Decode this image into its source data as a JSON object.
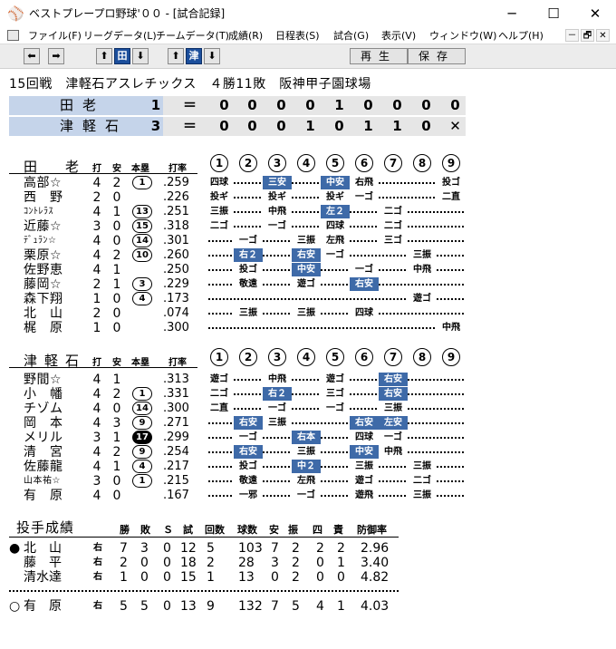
{
  "window": {
    "title": "ベストプレープロ野球'００ - [試合記録]",
    "minimize_glyph": "─",
    "maximize_glyph": "☐",
    "close_glyph": "✕"
  },
  "menu": {
    "items": [
      "ファイル(F)",
      "リーグデータ(L)",
      "チームデータ(T)",
      "成績(R)",
      "日程表(S)",
      "試合(G)",
      "表示(V)",
      "ウィンドウ(W)",
      "ヘルプ(H)"
    ],
    "mdi_min": "－",
    "mdi_restore": "🗗",
    "mdi_close": "✕"
  },
  "toolbar": {
    "prev_arrow": "⬅",
    "next_arrow": "➡",
    "team1_up": "⬆",
    "team1_label": "田",
    "team1_down": "⬇",
    "team2_up": "⬆",
    "team2_label": "津",
    "team2_down": "⬇",
    "replay_label": "再生",
    "save_label": "保存"
  },
  "game": {
    "header": "15回戦　津軽石アスレチックス　４勝11敗　阪神甲子園球場"
  },
  "scoreboard": [
    {
      "team": "田老",
      "total": "1",
      "eq": "＝",
      "innings": [
        "0",
        "0",
        "0",
        "0",
        "1",
        "0",
        "0",
        "0",
        "0"
      ]
    },
    {
      "team": "津軽石",
      "total": "3",
      "eq": "＝",
      "innings": [
        "0",
        "0",
        "0",
        "1",
        "0",
        "1",
        "1",
        "0",
        "✕"
      ]
    }
  ],
  "batting_headers": {
    "ab": "打",
    "h": "安",
    "hr": "本塁",
    "avg": "打率"
  },
  "inning_numbers": [
    "1",
    "2",
    "3",
    "4",
    "5",
    "6",
    "7",
    "8",
    "9"
  ],
  "batting": [
    {
      "team": "田　老",
      "players": [
        {
          "name": "高部☆",
          "ab": "4",
          "h": "2",
          "hr": "1",
          "avg": ".259",
          "results": [
            [
              "四球",
              1,
              false
            ],
            [
              "三安",
              3,
              true
            ],
            [
              "中安",
              5,
              true
            ],
            [
              "右飛",
              6,
              false
            ],
            [
              "投ゴ",
              9,
              false
            ]
          ]
        },
        {
          "name": "西　野",
          "ab": "2",
          "h": "0",
          "hr": "",
          "avg": ".226",
          "results": [
            [
              "投ギ",
              1,
              false
            ],
            [
              "投ギ",
              3,
              false
            ],
            [
              "投ギ",
              5,
              false
            ],
            [
              "一ゴ",
              6,
              false
            ],
            [
              "二直",
              9,
              false
            ]
          ]
        },
        {
          "name": "ｺﾝﾄﾚﾗｽ",
          "small": true,
          "ab": "4",
          "h": "1",
          "hr": "13",
          "avg": ".251",
          "results": [
            [
              "三振",
              1,
              false
            ],
            [
              "中飛",
              3,
              false
            ],
            [
              "左２",
              5,
              true
            ],
            [
              "二ゴ",
              7,
              false
            ]
          ]
        },
        {
          "name": "近藤☆",
          "ab": "3",
          "h": "0",
          "hr": "15",
          "avg": ".318",
          "results": [
            [
              "二ゴ",
              1,
              false
            ],
            [
              "一ゴ",
              3,
              false
            ],
            [
              "四球",
              5,
              false
            ],
            [
              "二ゴ",
              7,
              false
            ]
          ]
        },
        {
          "name": "ﾃﾞｭﾗﾝ☆",
          "small": true,
          "ab": "4",
          "h": "0",
          "hr": "14",
          "avg": ".301",
          "results": [
            [
              "一ゴ",
              2,
              false
            ],
            [
              "三振",
              4,
              false
            ],
            [
              "左飛",
              5,
              false
            ],
            [
              "三ゴ",
              7,
              false
            ]
          ]
        },
        {
          "name": "栗原☆",
          "ab": "4",
          "h": "2",
          "hr": "10",
          "avg": ".260",
          "results": [
            [
              "右２",
              2,
              true
            ],
            [
              "右安",
              4,
              true
            ],
            [
              "一ゴ",
              5,
              false
            ],
            [
              "三振",
              8,
              false
            ]
          ]
        },
        {
          "name": "佐野恵",
          "ab": "4",
          "h": "1",
          "hr": "",
          "avg": ".250",
          "results": [
            [
              "投ゴ",
              2,
              false
            ],
            [
              "中安",
              4,
              true
            ],
            [
              "一ゴ",
              6,
              false
            ],
            [
              "中飛",
              8,
              false
            ]
          ]
        },
        {
          "name": "藤岡☆",
          "ab": "2",
          "h": "1",
          "hr": "3",
          "avg": ".229",
          "results": [
            [
              "敬遠",
              2,
              false
            ],
            [
              "遊ゴ",
              4,
              false
            ],
            [
              "右安",
              6,
              true
            ]
          ]
        },
        {
          "name": "森下翔",
          "ab": "1",
          "h": "0",
          "hr": "4",
          "avg": ".173",
          "results": [
            [
              "遊ゴ",
              8,
              false
            ]
          ]
        },
        {
          "name": "北　山",
          "ab": "2",
          "h": "0",
          "hr": "",
          "avg": ".074",
          "results": [
            [
              "三振",
              2,
              false
            ],
            [
              "三振",
              4,
              false
            ],
            [
              "四球",
              6,
              false
            ]
          ]
        },
        {
          "name": "梶　原",
          "ab": "1",
          "h": "0",
          "hr": "",
          "avg": ".300",
          "results": [
            [
              "中飛",
              9,
              false
            ]
          ]
        }
      ]
    },
    {
      "team": "津軽石",
      "players": [
        {
          "name": "野間☆",
          "ab": "4",
          "h": "1",
          "hr": "",
          "avg": ".313",
          "results": [
            [
              "遊ゴ",
              1,
              false
            ],
            [
              "中飛",
              3,
              false
            ],
            [
              "遊ゴ",
              5,
              false
            ],
            [
              "右安",
              7,
              true
            ]
          ]
        },
        {
          "name": "小　幡",
          "ab": "4",
          "h": "2",
          "hr": "1",
          "avg": ".331",
          "results": [
            [
              "二ゴ",
              1,
              false
            ],
            [
              "右２",
              3,
              true
            ],
            [
              "三ゴ",
              5,
              false
            ],
            [
              "右安",
              7,
              true
            ]
          ]
        },
        {
          "name": "チゾム",
          "ab": "4",
          "h": "0",
          "hr": "14",
          "avg": ".300",
          "results": [
            [
              "二直",
              1,
              false
            ],
            [
              "一ゴ",
              3,
              false
            ],
            [
              "一ゴ",
              5,
              false
            ],
            [
              "三振",
              7,
              false
            ]
          ]
        },
        {
          "name": "岡　本",
          "ab": "4",
          "h": "3",
          "hr": "9",
          "avg": ".271",
          "results": [
            [
              "右安",
              2,
              true
            ],
            [
              "三振",
              3,
              false
            ],
            [
              "右安",
              6,
              true
            ],
            [
              "左安",
              7,
              true
            ]
          ]
        },
        {
          "name": "メリル",
          "ab": "3",
          "h": "1",
          "hr": "17",
          "hrFilled": true,
          "avg": ".299",
          "results": [
            [
              "一ゴ",
              2,
              false
            ],
            [
              "右本",
              4,
              true
            ],
            [
              "四球",
              6,
              false
            ],
            [
              "一ゴ",
              7,
              false
            ]
          ]
        },
        {
          "name": "清　宮",
          "ab": "4",
          "h": "2",
          "hr": "9",
          "avg": ".254",
          "results": [
            [
              "右安",
              2,
              true
            ],
            [
              "三振",
              4,
              false
            ],
            [
              "中安",
              6,
              true
            ],
            [
              "中飛",
              7,
              false
            ]
          ]
        },
        {
          "name": "佐藤龍",
          "ab": "4",
          "h": "1",
          "hr": "4",
          "avg": ".217",
          "results": [
            [
              "投ゴ",
              2,
              false
            ],
            [
              "中２",
              4,
              true
            ],
            [
              "三振",
              6,
              false
            ],
            [
              "三振",
              8,
              false
            ]
          ]
        },
        {
          "name": "山本祐☆",
          "small": true,
          "ab": "3",
          "h": "0",
          "hr": "1",
          "avg": ".215",
          "results": [
            [
              "敬遠",
              2,
              false
            ],
            [
              "左飛",
              4,
              false
            ],
            [
              "遊ゴ",
              6,
              false
            ],
            [
              "二ゴ",
              8,
              false
            ]
          ]
        },
        {
          "name": "有　原",
          "ab": "4",
          "h": "0",
          "hr": "",
          "avg": ".167",
          "results": [
            [
              "一邪",
              2,
              false
            ],
            [
              "一ゴ",
              4,
              false
            ],
            [
              "遊飛",
              6,
              false
            ],
            [
              "三振",
              8,
              false
            ]
          ]
        }
      ]
    }
  ],
  "pitching": {
    "title": "投手成績",
    "headers": [
      "勝",
      "敗",
      "Ｓ",
      "試",
      "回数",
      "球数",
      "安",
      "振",
      "四",
      "責",
      "防御率"
    ],
    "rows": [
      {
        "mark": "●",
        "name": "北　山",
        "hand": "右",
        "vals": [
          "7",
          "3",
          "0",
          "12",
          "5",
          "103",
          "7",
          "2",
          "2",
          "2",
          "2.96"
        ]
      },
      {
        "mark": "",
        "name": "藤　平",
        "hand": "右",
        "vals": [
          "2",
          "0",
          "0",
          "18",
          "2",
          "28",
          "3",
          "2",
          "0",
          "1",
          "3.40"
        ]
      },
      {
        "mark": "",
        "name": "清水達",
        "hand": "右",
        "vals": [
          "1",
          "0",
          "0",
          "15",
          "1",
          "13",
          "0",
          "2",
          "0",
          "0",
          "4.82"
        ]
      },
      {
        "mark": "○",
        "name": "有　原",
        "hand": "右",
        "vals": [
          "5",
          "5",
          "0",
          "13",
          "9",
          "132",
          "7",
          "5",
          "4",
          "1",
          "4.03"
        ]
      }
    ]
  }
}
